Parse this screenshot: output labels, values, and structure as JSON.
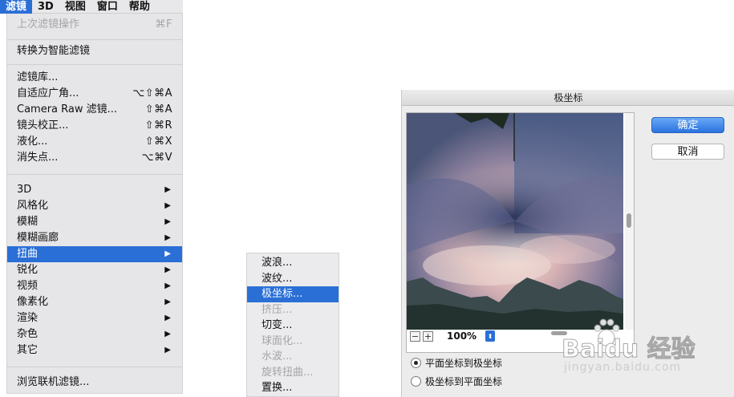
{
  "menubar": {
    "items": [
      {
        "label": "滤镜",
        "active": true
      },
      {
        "label": "3D",
        "active": false
      },
      {
        "label": "视图",
        "active": false
      },
      {
        "label": "窗口",
        "active": false
      },
      {
        "label": "帮助",
        "active": false
      }
    ]
  },
  "filter_menu": {
    "last_filter": {
      "label": "上次滤镜操作",
      "shortcut": "⌘F"
    },
    "convert_smart": {
      "label": "转换为智能滤镜"
    },
    "filter_gallery": {
      "label": "滤镜库..."
    },
    "adaptive_wide_angle": {
      "label": "自适应广角...",
      "shortcut": "⌥⇧⌘A"
    },
    "camera_raw": {
      "label": "Camera Raw 滤镜...",
      "shortcut": "⇧⌘A"
    },
    "lens_correction": {
      "label": "镜头校正...",
      "shortcut": "⇧⌘R"
    },
    "liquify": {
      "label": "液化...",
      "shortcut": "⇧⌘X"
    },
    "vanishing_point": {
      "label": "消失点...",
      "shortcut": "⌥⌘V"
    },
    "submenus": [
      {
        "label": "3D"
      },
      {
        "label": "风格化"
      },
      {
        "label": "模糊"
      },
      {
        "label": "模糊画廊"
      },
      {
        "label": "扭曲"
      },
      {
        "label": "锐化"
      },
      {
        "label": "视频"
      },
      {
        "label": "像素化"
      },
      {
        "label": "渲染"
      },
      {
        "label": "杂色"
      },
      {
        "label": "其它"
      }
    ],
    "submenu_arrow": "▶",
    "browse_online": {
      "label": "浏览联机滤镜..."
    }
  },
  "distort_submenu": {
    "items": [
      {
        "label": "波浪...",
        "enabled": true
      },
      {
        "label": "波纹...",
        "enabled": true
      },
      {
        "label": "极坐标...",
        "enabled": true,
        "selected": true
      },
      {
        "label": "挤压...",
        "enabled": false
      },
      {
        "label": "切变...",
        "enabled": true
      },
      {
        "label": "球面化...",
        "enabled": false
      },
      {
        "label": "水波...",
        "enabled": false
      },
      {
        "label": "旋转扭曲...",
        "enabled": false
      },
      {
        "label": "置换...",
        "enabled": true
      }
    ]
  },
  "polar_dialog": {
    "title": "极坐标",
    "ok_label": "确定",
    "cancel_label": "取消",
    "zoom": {
      "minus": "−",
      "plus": "+",
      "value": "100%",
      "dropdown_icon": "⬍"
    },
    "options": [
      {
        "label": "平面坐标到极坐标",
        "checked": true
      },
      {
        "label": "极坐标到平面坐标",
        "checked": false
      }
    ]
  },
  "watermark": {
    "logo": "Baidu 经验",
    "url": "jingyan.baidu.com"
  },
  "colors": {
    "selection": "#2a6fd6",
    "menu_bg": "#e6e5e8",
    "disabled_text": "#a5a5a8"
  }
}
